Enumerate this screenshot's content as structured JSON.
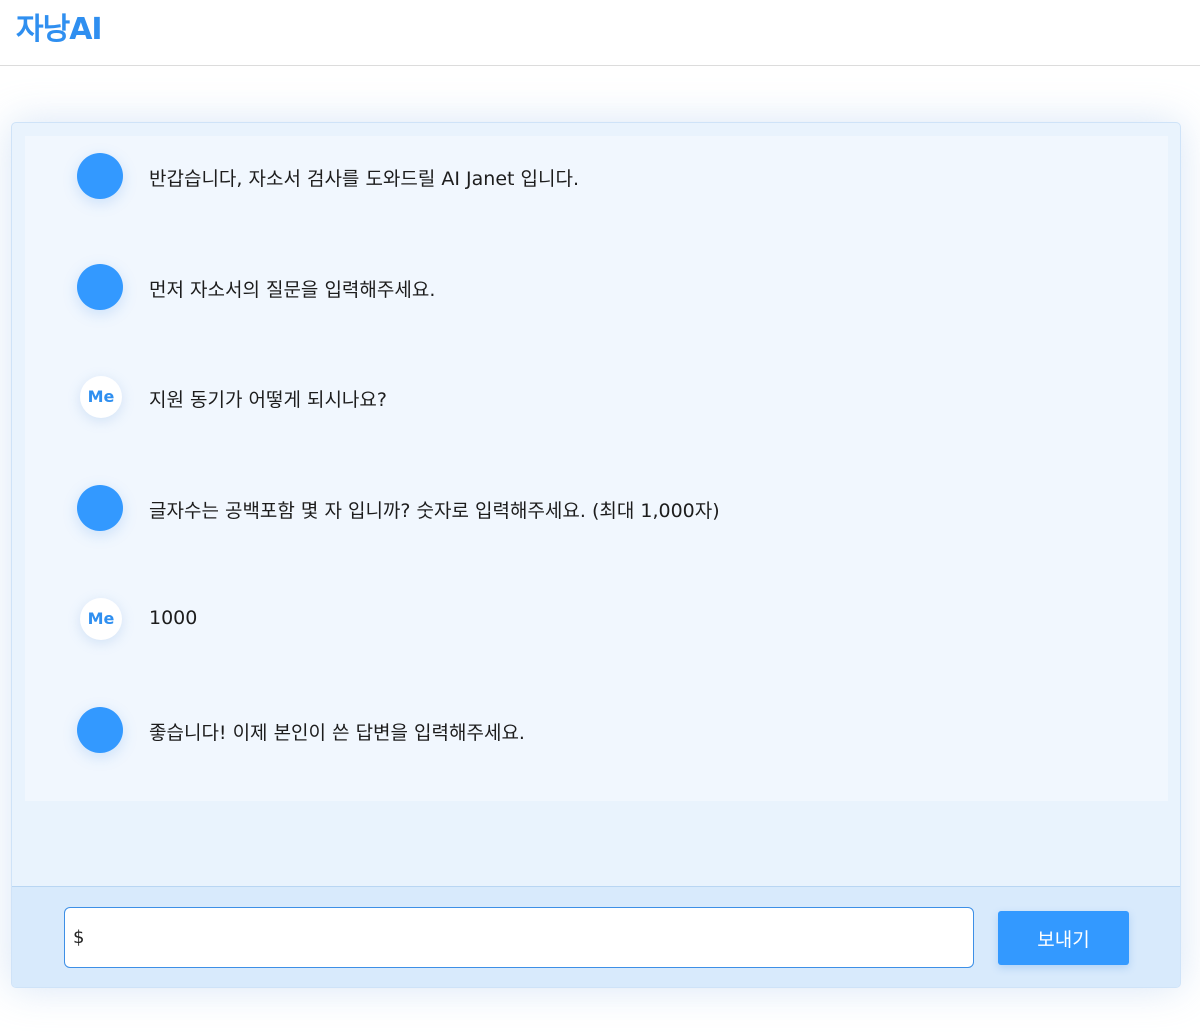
{
  "header": {
    "logo_text": "자낭AI"
  },
  "chat": {
    "messages": [
      {
        "sender": "bot",
        "avatar_label": "",
        "text": "반갑습니다, 자소서 검사를 도와드릴 AI Janet 입니다."
      },
      {
        "sender": "bot",
        "avatar_label": "",
        "text": "먼저 자소서의 질문을 입력해주세요."
      },
      {
        "sender": "me",
        "avatar_label": "Me",
        "text": "지원 동기가 어떻게 되시나요?"
      },
      {
        "sender": "bot",
        "avatar_label": "",
        "text": "글자수는 공백포함 몇 자 입니까? 숫자로 입력해주세요. (최대 1,000자)"
      },
      {
        "sender": "me",
        "avatar_label": "Me",
        "text": "1000"
      },
      {
        "sender": "bot",
        "avatar_label": "",
        "text": "좋습니다! 이제 본인이 쓴 답변을 입력해주세요."
      }
    ]
  },
  "input_bar": {
    "input_value": "$",
    "send_label": "보내기"
  },
  "colors": {
    "accent": "#3399ff",
    "panel_bg": "#e9f3fd",
    "messages_bg": "#f1f7fe",
    "input_bar_bg": "#d8eafc"
  }
}
